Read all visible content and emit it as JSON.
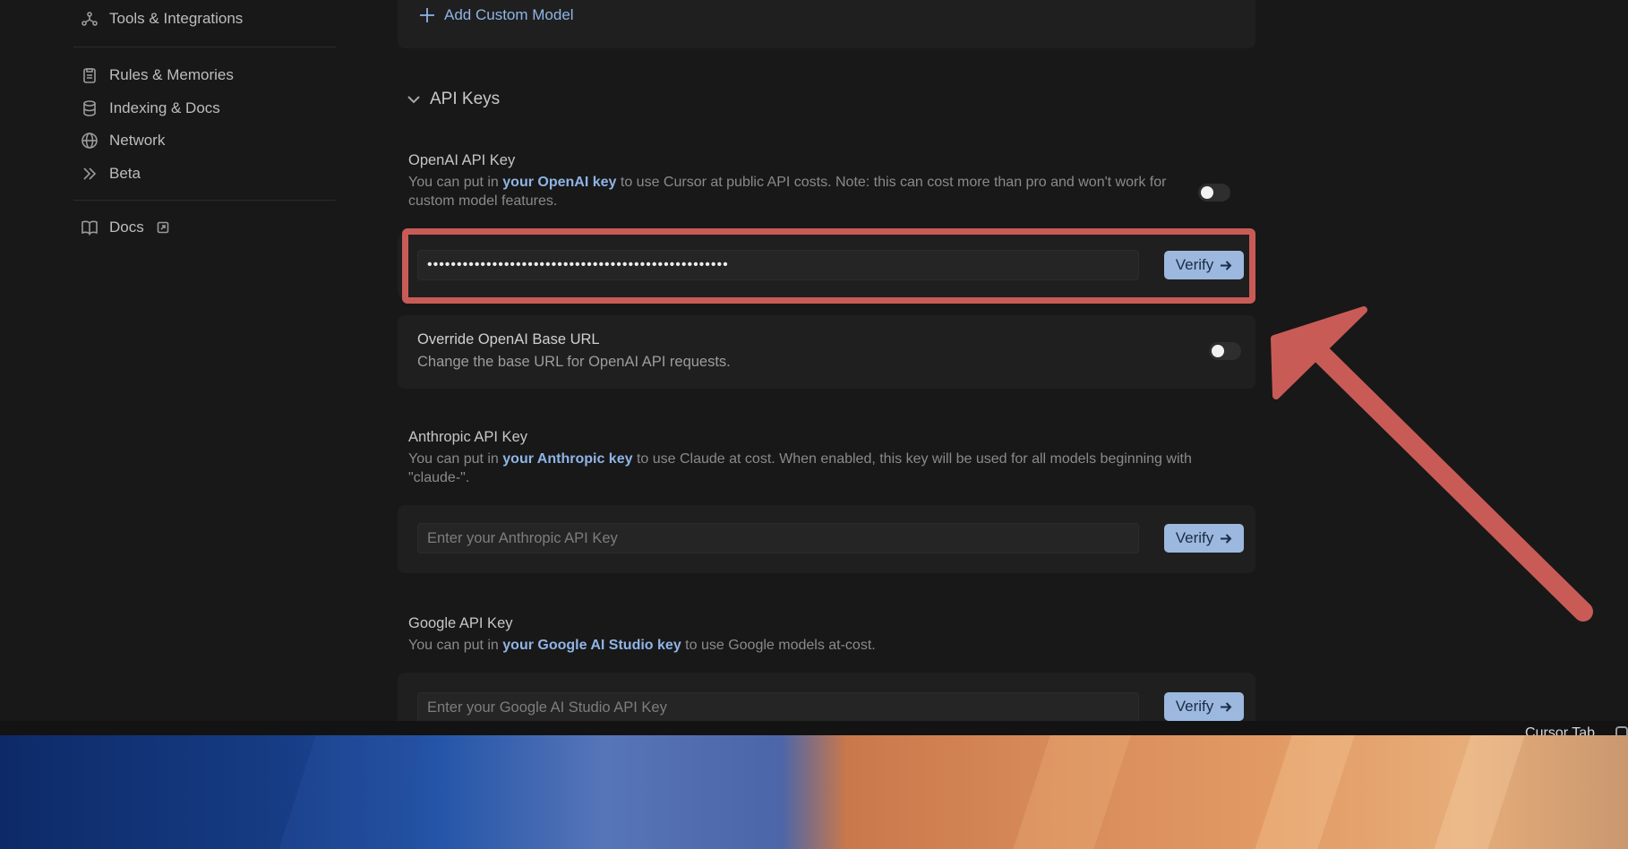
{
  "sidebar": {
    "items": [
      {
        "label": "Tools & Integrations",
        "icon": "tools-icon"
      },
      {
        "label": "Rules & Memories",
        "icon": "clipboard-icon"
      },
      {
        "label": "Indexing & Docs",
        "icon": "database-icon"
      },
      {
        "label": "Network",
        "icon": "globe-icon"
      },
      {
        "label": "Beta",
        "icon": "chevrons-right-icon"
      },
      {
        "label": "Docs",
        "icon": "book-icon",
        "external_icon": "external-link-icon"
      }
    ]
  },
  "main": {
    "add_custom_model": "Add Custom Model",
    "api_keys_section": "API Keys",
    "openai": {
      "title": "OpenAI API Key",
      "desc_prefix": "You can put in ",
      "desc_link": "your OpenAI key",
      "desc_suffix": " to use Cursor at public API costs. Note: this can cost more than pro and won't work for custom model features.",
      "value": "•••••••••••••••••••••••••••••••••••••••••••••••••••",
      "toggle_on": false
    },
    "override": {
      "title": "Override OpenAI Base URL",
      "desc": "Change the base URL for OpenAI API requests.",
      "toggle_on": false
    },
    "anthropic": {
      "title": "Anthropic API Key",
      "desc_prefix": "You can put in ",
      "desc_link": "your Anthropic key",
      "desc_suffix": " to use Claude at cost. When enabled, this key will be used for all models beginning with \"claude-\".",
      "placeholder": "Enter your Anthropic API Key"
    },
    "google": {
      "title": "Google API Key",
      "desc_prefix": "You can put in ",
      "desc_link": "your Google AI Studio key",
      "desc_suffix": " to use Google models at-cost.",
      "placeholder": "Enter your Google AI Studio API Key"
    },
    "verify_label": "Verify"
  },
  "statusbar": {
    "text": "Cursor Tab"
  },
  "colors": {
    "accent": "#8fb4e6",
    "verify_bg": "#9cb8de",
    "annotation": "#c95b57",
    "background": "#181818"
  }
}
